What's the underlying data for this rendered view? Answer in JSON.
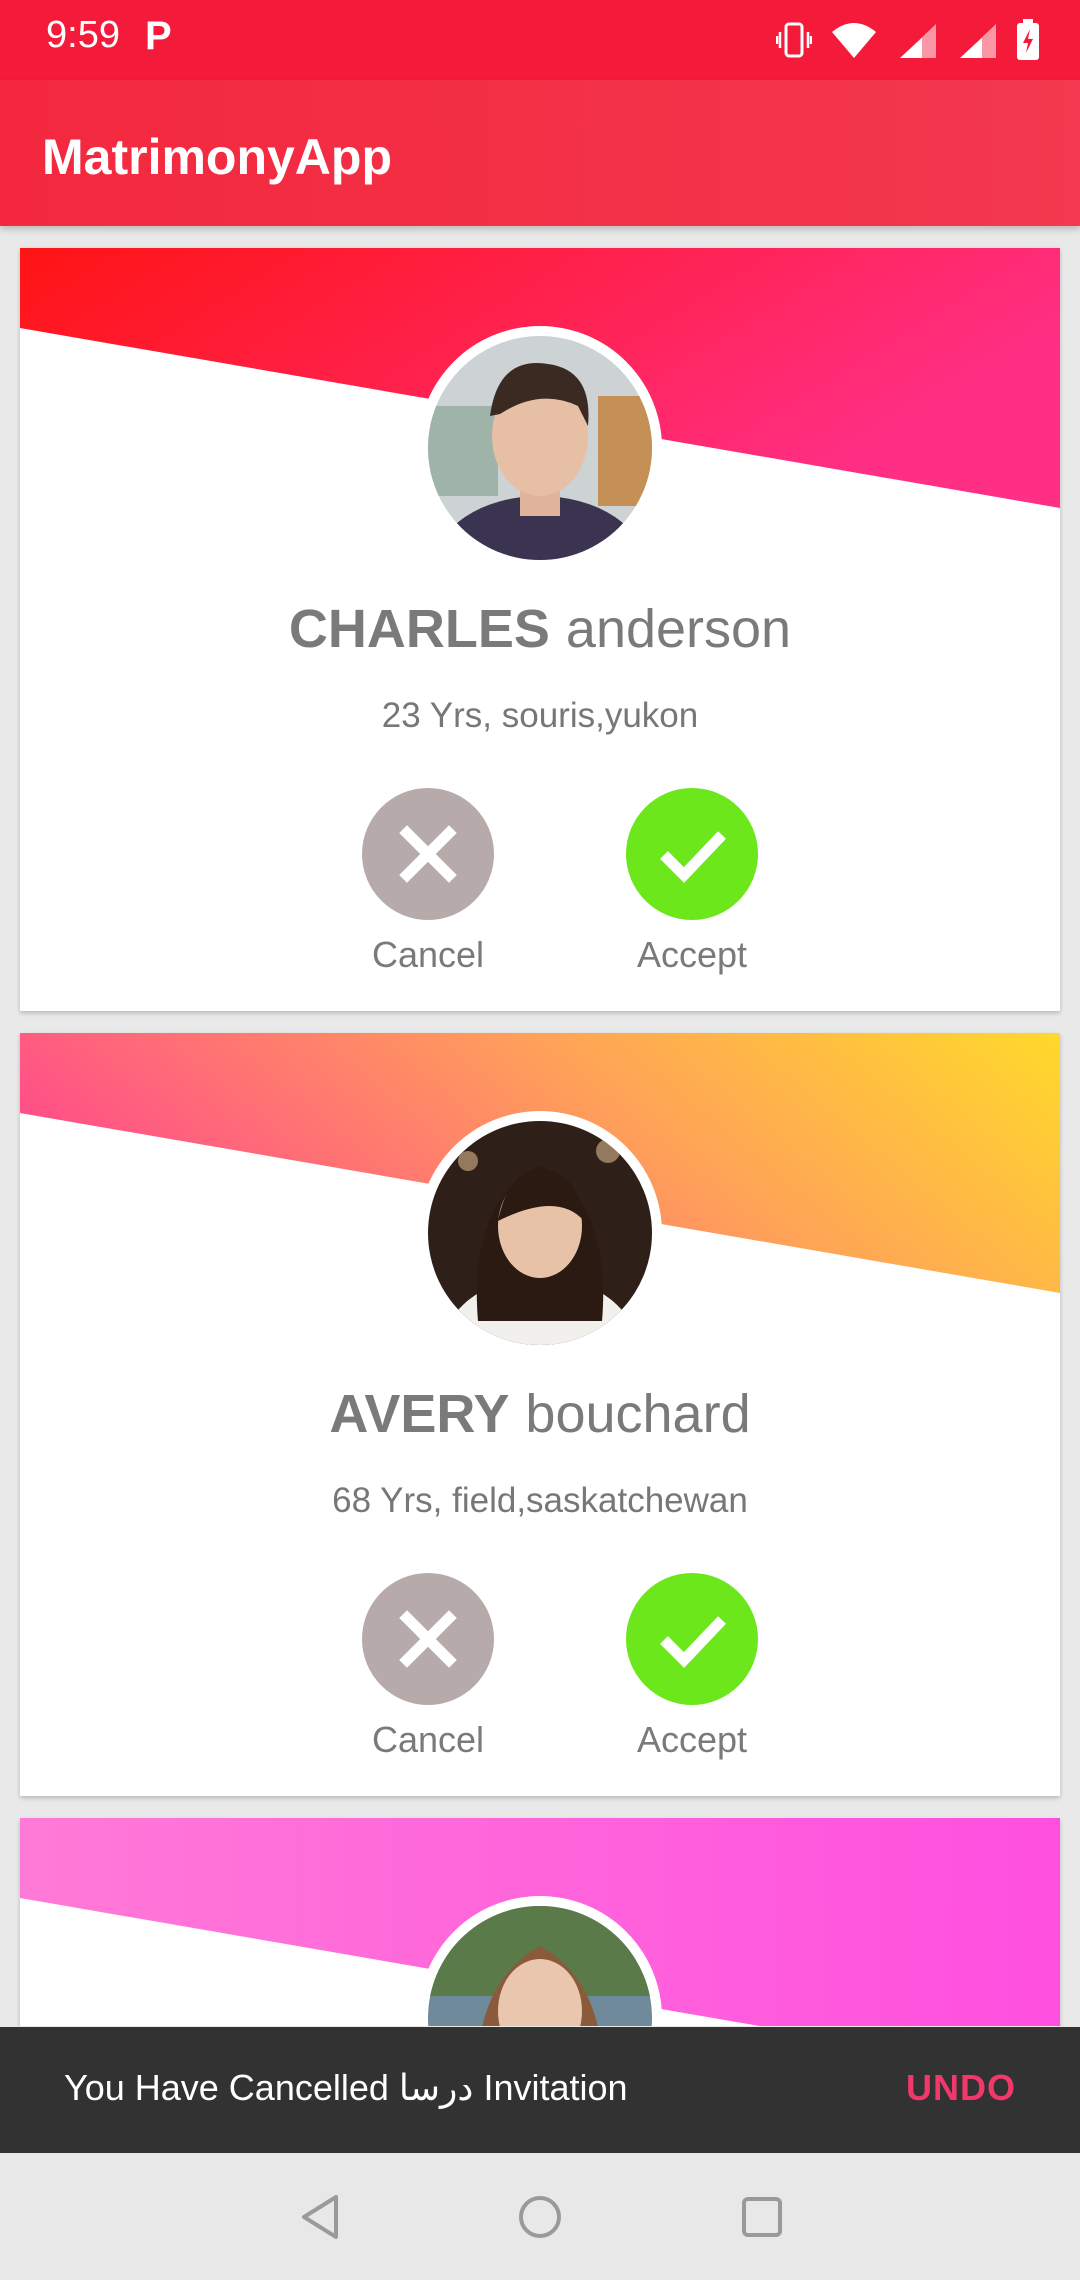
{
  "status_bar": {
    "time": "9:59",
    "notification": "P"
  },
  "app_bar": {
    "title": "MatrimonyApp"
  },
  "profiles": [
    {
      "first_name": "CHARLES",
      "last_name": "anderson",
      "info": "23 Yrs, souris,yukon",
      "cancel_label": "Cancel",
      "accept_label": "Accept"
    },
    {
      "first_name": "AVERY",
      "last_name": "bouchard",
      "info": "68 Yrs, field,saskatchewan",
      "cancel_label": "Cancel",
      "accept_label": "Accept"
    }
  ],
  "snackbar": {
    "message": "You Have Cancelled درسا Invitation",
    "action": "UNDO"
  },
  "icons": [
    "vibrate-icon",
    "wifi-icon",
    "signal-icon",
    "battery-icon",
    "close-icon",
    "check-icon",
    "back-icon",
    "home-icon",
    "recents-icon"
  ],
  "colors": {
    "app_bar": "#f3283e",
    "accept": "#6ce71c",
    "cancel": "#b6aaaa",
    "snackbar_action": "#f0386a"
  }
}
